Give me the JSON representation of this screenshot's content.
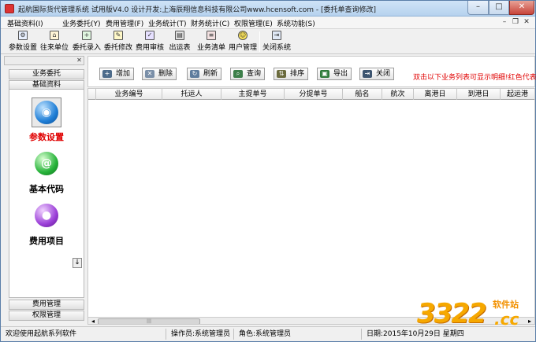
{
  "window": {
    "title": "起航国际货代管理系统 试用版V4.0 设计开发:上海辰翔信息科技有限公司www.hcensoft.com - [委托单查询修改]"
  },
  "menubar": {
    "items": [
      {
        "label": "基础资料(I)"
      },
      {
        "label": "业务委托(Y)"
      },
      {
        "label": "费用管理(F)"
      },
      {
        "label": "业务统计(T)"
      },
      {
        "label": "财务统计(C)"
      },
      {
        "label": "权限管理(E)"
      },
      {
        "label": "系统功能(S)"
      }
    ]
  },
  "toolbar": {
    "buttons": [
      {
        "label": "参数设置",
        "icon": "settings-icon"
      },
      {
        "label": "往来单位",
        "icon": "company-icon"
      },
      {
        "label": "委托录入",
        "icon": "entry-icon"
      },
      {
        "label": "委托修改",
        "icon": "edit-icon"
      },
      {
        "label": "费用审核",
        "icon": "audit-icon"
      },
      {
        "label": "出运表",
        "icon": "shipping-icon"
      },
      {
        "label": "业务清单",
        "icon": "list-icon"
      },
      {
        "label": "用户管理",
        "icon": "user-icon"
      },
      {
        "label": "关闭系统",
        "icon": "exit-icon"
      }
    ]
  },
  "sidebar": {
    "tabs_top": [
      {
        "label": "业务委托"
      },
      {
        "label": "基础资料"
      }
    ],
    "items": [
      {
        "label": "参数设置",
        "icon": "globe-icon",
        "active": true
      },
      {
        "label": "基本代码",
        "icon": "at-sign-icon",
        "active": false
      },
      {
        "label": "费用项目",
        "icon": "purple-orb-icon",
        "active": false
      }
    ],
    "tabs_bottom": [
      {
        "label": "费用管理"
      },
      {
        "label": "权限管理"
      }
    ]
  },
  "actions": {
    "buttons": [
      {
        "label": "增加",
        "icon": "add-icon"
      },
      {
        "label": "删除",
        "icon": "delete-icon"
      },
      {
        "label": "刷新",
        "icon": "refresh-icon"
      },
      {
        "label": "查询",
        "icon": "query-icon"
      },
      {
        "label": "排序",
        "icon": "sort-icon"
      },
      {
        "label": "导出",
        "icon": "export-icon"
      },
      {
        "label": "关闭",
        "icon": "close-doc-icon"
      }
    ],
    "hint": "双击以下业务列表可显示明细!红色代表"
  },
  "grid": {
    "columns": [
      {
        "label": "业务编号"
      },
      {
        "label": "托运人"
      },
      {
        "label": "主提单号"
      },
      {
        "label": "分提单号"
      },
      {
        "label": "船名"
      },
      {
        "label": "航次"
      },
      {
        "label": "离港日"
      },
      {
        "label": "到港日"
      },
      {
        "label": "起运港"
      }
    ],
    "rows": []
  },
  "statusbar": {
    "message": "欢迎使用起航系列软件",
    "operator": "操作员:系统管理员",
    "role": "角色:系统管理员",
    "date": "日期:2015年10月29日 星期四"
  },
  "watermark": {
    "digits": "3322",
    "site": "软件站",
    "domain": ".cc"
  },
  "colors": {
    "hint_red": "#e00000",
    "active_red": "#e00000",
    "title_gradient": "#b6d2ee"
  }
}
